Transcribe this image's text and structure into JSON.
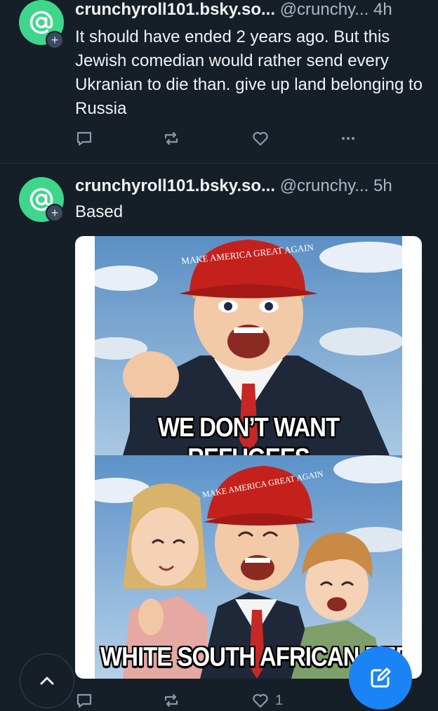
{
  "posts": [
    {
      "display_name": "crunchyroll101.bsky.so...",
      "handle": "@crunchy...",
      "time": "4h",
      "text": "It should have ended 2 years ago. But this Jewish comedian would rather send every Ukranian to die than. give up land belonging to Russia",
      "avatar_icon": "at-sign-icon",
      "follow_badge": "+"
    },
    {
      "display_name": "crunchyroll101.bsky.so...",
      "handle": "@crunchy...",
      "time": "5h",
      "text": "Based",
      "avatar_icon": "at-sign-icon",
      "follow_badge": "+",
      "image": {
        "top_hat_text": "MAKE AMERICA GREAT AGAIN",
        "top_caption": "WE DON’T WANT REFUGEES",
        "bottom_hat_text": "MAKE AMERICA GREAT AGAIN",
        "bottom_caption": "WHITE SOUTH AFRICAN REFU"
      },
      "like_count": "1"
    }
  ],
  "colors": {
    "background": "#161e27",
    "avatar": "#3ed68b",
    "accent": "#1a83f5",
    "muted_text": "#aeb8c4"
  },
  "icons": [
    "reply-icon",
    "repost-icon",
    "like-icon",
    "more-icon",
    "chevron-up-icon",
    "compose-icon"
  ]
}
